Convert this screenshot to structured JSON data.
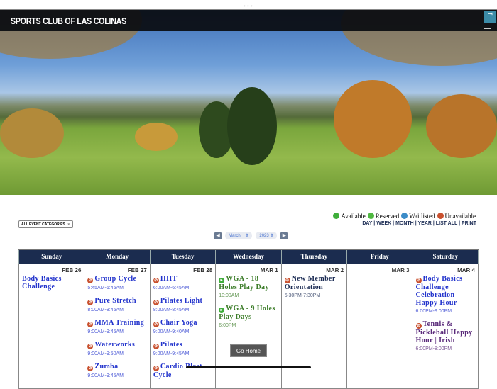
{
  "site": {
    "title": "SPORTS CLUB OF LAS COLINAS"
  },
  "filter": {
    "category": "ALL EVENT CATEGORIES"
  },
  "legend": [
    {
      "label": "Available",
      "color": "#3fae3b"
    },
    {
      "label": "Reserved",
      "color": "#4fb840"
    },
    {
      "label": "Waitlisted",
      "color": "#3c8cc8"
    },
    {
      "label": "Unavailable",
      "color": "#c9512f"
    }
  ],
  "views": [
    "DAY",
    "WEEK",
    "MONTH",
    "YEAR",
    "LIST ALL",
    "PRINT"
  ],
  "nav": {
    "month": "March",
    "year": "2023"
  },
  "days": [
    "Sunday",
    "Monday",
    "Tuesday",
    "Wednesday",
    "Thursday",
    "Friday",
    "Saturday"
  ],
  "week": [
    {
      "date": "FEB 26",
      "events": [
        {
          "title": "Body Basics Challenge",
          "time": "",
          "status": "none",
          "color": "#2233cc"
        }
      ]
    },
    {
      "date": "FEB 27",
      "events": [
        {
          "title": "Group Cycle",
          "time": "5:45AM-6:45AM",
          "status": "unavailable",
          "color": "#2233cc"
        },
        {
          "title": "Pure Stretch",
          "time": "8:00AM-8:45AM",
          "status": "unavailable",
          "color": "#2233cc"
        },
        {
          "title": "MMA Training",
          "time": "9:00AM-9:45AM",
          "status": "unavailable",
          "color": "#2233cc"
        },
        {
          "title": "Waterworks",
          "time": "9:00AM-9:50AM",
          "status": "unavailable",
          "color": "#2233cc"
        },
        {
          "title": "Zumba",
          "time": "9:00AM-9:45AM",
          "status": "unavailable",
          "color": "#2233cc"
        }
      ]
    },
    {
      "date": "FEB 28",
      "events": [
        {
          "title": "HIIT",
          "time": "6:00AM-6:45AM",
          "status": "unavailable",
          "color": "#2233cc"
        },
        {
          "title": "Pilates Light",
          "time": "8:00AM-8:45AM",
          "status": "unavailable",
          "color": "#2233cc"
        },
        {
          "title": "Chair Yoga",
          "time": "9:00AM-9:40AM",
          "status": "unavailable",
          "color": "#2233cc"
        },
        {
          "title": "Pilates",
          "time": "9:00AM-9:45AM",
          "status": "unavailable",
          "color": "#2233cc"
        },
        {
          "title": "Cardio Blast Cycle",
          "time": "",
          "status": "unavailable",
          "color": "#2233cc"
        }
      ]
    },
    {
      "date": "MAR 1",
      "events": [
        {
          "title": "WGA - 18 Holes Play Day",
          "time": "10:00AM",
          "status": "available",
          "color": "#3d7d2a"
        },
        {
          "title": "WGA - 9 Holes Play Days",
          "time": "6:00PM",
          "status": "available",
          "color": "#3d7d2a"
        }
      ]
    },
    {
      "date": "MAR 2",
      "events": [
        {
          "title": "New Member Orientation",
          "time": "5:30PM-7:30PM",
          "status": "unavailable",
          "color": "#1d2d55"
        }
      ]
    },
    {
      "date": "MAR 3",
      "events": []
    },
    {
      "date": "MAR 4",
      "events": [
        {
          "title": "Body Basics Challenge Celebration Happy Hour",
          "time": "6:00PM-9:00PM",
          "status": "unavailable",
          "color": "#2233cc"
        },
        {
          "title": "Tennis & Pickleball Happy Hour | Irish",
          "time": "6:00PM-8:00PM",
          "status": "unavailable",
          "color": "#5a2a7a"
        }
      ]
    }
  ],
  "go_home": "Go Home"
}
